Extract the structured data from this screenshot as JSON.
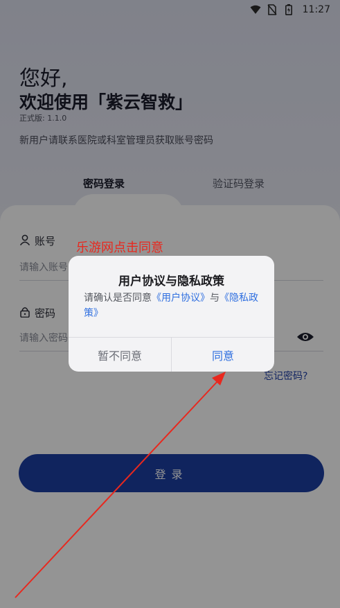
{
  "status_bar": {
    "time": "11:27"
  },
  "header": {
    "greeting": "您好,",
    "welcome": "欢迎使用「紫云智救」",
    "version": "正式版: 1.1.0",
    "hint": "新用户请联系医院或科室管理员获取账号密码"
  },
  "tabs": {
    "password_login": "密码登录",
    "code_login": "验证码登录"
  },
  "form": {
    "account_label": "账号",
    "account_placeholder": "请输入账号",
    "password_label": "密码",
    "password_placeholder": "请输入密码",
    "forgot_password": "忘记密码?",
    "login_button": "登录"
  },
  "dialog": {
    "title": "用户协议与隐私政策",
    "body_prefix": "请确认是否同意",
    "user_agreement": "《用户协议》",
    "body_and": "与",
    "privacy_policy": "《隐私政策》",
    "disagree_button": "暂不同意",
    "agree_button": "同意"
  },
  "annotation": {
    "text": "乐游网点击同意"
  },
  "colors": {
    "primary": "#1d3ea3",
    "link": "#2f6fe0",
    "annotation": "#e8281e"
  }
}
